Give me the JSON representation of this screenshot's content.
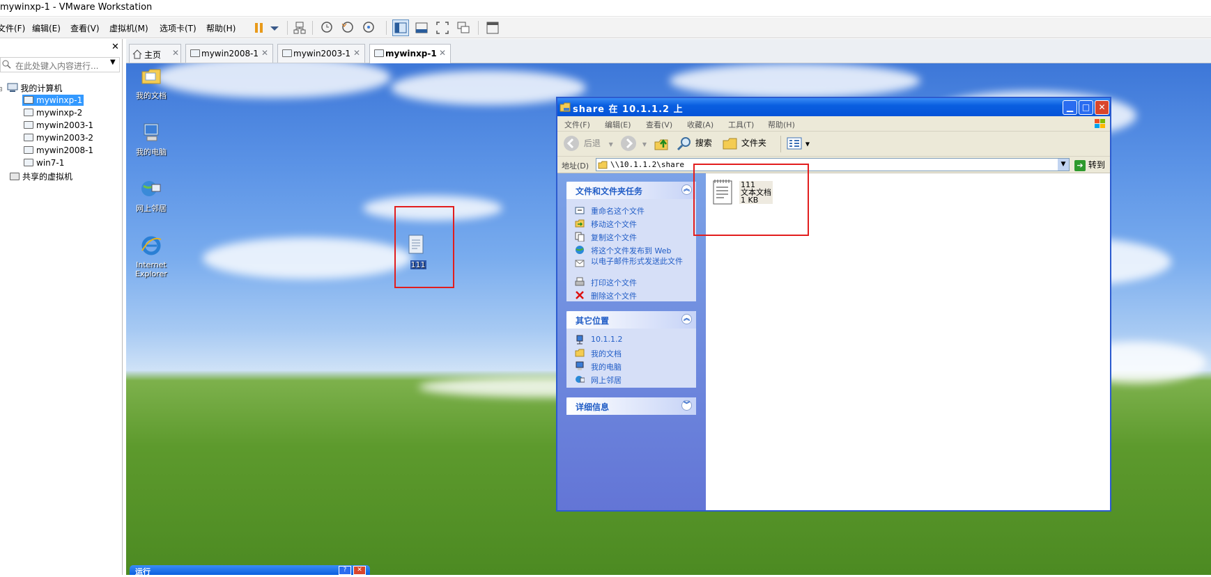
{
  "window": {
    "title": "mywinxp-1 - VMware Workstation"
  },
  "menu": [
    "文件(F)",
    "编辑(E)",
    "查看(V)",
    "虚拟机(M)",
    "选项卡(T)",
    "帮助(H)"
  ],
  "library": {
    "search_placeholder": "在此处键入内容进行...",
    "root": "我的计算机",
    "vms": [
      "mywinxp-1",
      "mywinxp-2",
      "mywin2003-1",
      "mywin2003-2",
      "mywin2008-1",
      "win7-1"
    ],
    "shared": "共享的虚拟机",
    "selected": "mywinxp-1"
  },
  "tabs": [
    {
      "label": "主页",
      "active": false
    },
    {
      "label": "mywin2008-1",
      "active": false
    },
    {
      "label": "mywin2003-1",
      "active": false
    },
    {
      "label": "mywinxp-1",
      "active": true
    }
  ],
  "desktop": {
    "icons": [
      "我的文档",
      "我的电脑",
      "网上邻居",
      "Internet Explorer"
    ],
    "file_icon": "111"
  },
  "explorer": {
    "title": "share 在 10.1.1.2 上",
    "menu": [
      "文件(F)",
      "编辑(E)",
      "查看(V)",
      "收藏(A)",
      "工具(T)",
      "帮助(H)"
    ],
    "toolbar": {
      "back": "后退",
      "search": "搜索",
      "folders": "文件夹"
    },
    "address_label": "地址(D)",
    "address": "\\\\10.1.1.2\\share",
    "go": "转到",
    "tasks_title": "文件和文件夹任务",
    "tasks": [
      "重命名这个文件",
      "移动这个文件",
      "复制这个文件",
      "将这个文件发布到 Web",
      "以电子邮件形式发送此文件",
      "打印这个文件",
      "删除这个文件"
    ],
    "places_title": "其它位置",
    "places": [
      "10.1.1.2",
      "我的文档",
      "我的电脑",
      "网上邻居"
    ],
    "details_title": "详细信息",
    "file": {
      "name": "111",
      "type": "文本文档",
      "size": "1 KB"
    }
  },
  "run_dialog": {
    "title": "运行"
  }
}
